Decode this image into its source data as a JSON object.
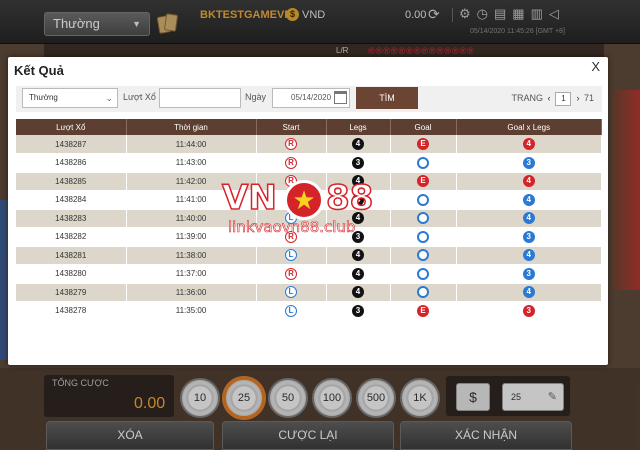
{
  "topbar": {
    "mode": "Thường",
    "brand": "BKTESTGAMEVN",
    "currency": "VND",
    "balance": "0.00",
    "datetime": "05/14/2020 11:45:26 [GMT +8]"
  },
  "board": {
    "lr": "L/R",
    "rs": "®®®®®®®®®®®®®®"
  },
  "bottom": {
    "total_label": "TỔNG CƯỢC",
    "total_value": "0.00",
    "chips": [
      "10",
      "25",
      "50",
      "100",
      "500",
      "1K"
    ],
    "active_chip": "25",
    "dollar": "$",
    "bet_value": "25",
    "delete_label": "XÓA",
    "rebet_label": "CƯỢC LẠI",
    "confirm_label": "XÁC NHẬN"
  },
  "modal": {
    "title": "Kết Quả",
    "close": "X",
    "filter": {
      "select_value": "Thường",
      "draw_label": "Lượt Xổ",
      "draw_value": "",
      "date_label": "Ngày",
      "date_value": "05/14/2020",
      "search_label": "TÌM"
    },
    "pager": {
      "label": "TRANG",
      "current": "1",
      "total": "71"
    },
    "columns": [
      "Lượt Xổ",
      "Thời gian",
      "Start",
      "Legs",
      "Goal",
      "Goal x Legs"
    ],
    "rows": [
      {
        "id": "1438287",
        "time": "11:44:00",
        "start": "R",
        "legs": "4",
        "goal": "E",
        "gxl": "4",
        "gxl_color": "red"
      },
      {
        "id": "1438286",
        "time": "11:43:00",
        "start": "R",
        "legs": "3",
        "goal": "O",
        "gxl": "3",
        "gxl_color": "blue"
      },
      {
        "id": "1438285",
        "time": "11:42:00",
        "start": "R",
        "legs": "4",
        "goal": "E",
        "gxl": "4",
        "gxl_color": "red"
      },
      {
        "id": "1438284",
        "time": "11:41:00",
        "start": "R",
        "legs": "4",
        "goal": "O",
        "gxl": "4",
        "gxl_color": "blue"
      },
      {
        "id": "1438283",
        "time": "11:40:00",
        "start": "L",
        "legs": "4",
        "goal": "O",
        "gxl": "4",
        "gxl_color": "blue"
      },
      {
        "id": "1438282",
        "time": "11:39:00",
        "start": "R",
        "legs": "3",
        "goal": "O",
        "gxl": "3",
        "gxl_color": "blue"
      },
      {
        "id": "1438281",
        "time": "11:38:00",
        "start": "L",
        "legs": "4",
        "goal": "O",
        "gxl": "4",
        "gxl_color": "blue"
      },
      {
        "id": "1438280",
        "time": "11:37:00",
        "start": "R",
        "legs": "4",
        "goal": "O",
        "gxl": "3",
        "gxl_color": "blue"
      },
      {
        "id": "1438279",
        "time": "11:36:00",
        "start": "L",
        "legs": "4",
        "goal": "O",
        "gxl": "4",
        "gxl_color": "blue"
      },
      {
        "id": "1438278",
        "time": "11:35:00",
        "start": "L",
        "legs": "3",
        "goal": "E",
        "gxl": "3",
        "gxl_color": "red"
      }
    ]
  },
  "watermark": {
    "vn": "VN",
    "num": "88",
    "link": "linkvaovn88.club"
  },
  "colors": {
    "header_brown": "#5d3f31",
    "red": "#d5232a",
    "blue": "#2a7ad5",
    "accent_orange": "#e8a030"
  }
}
